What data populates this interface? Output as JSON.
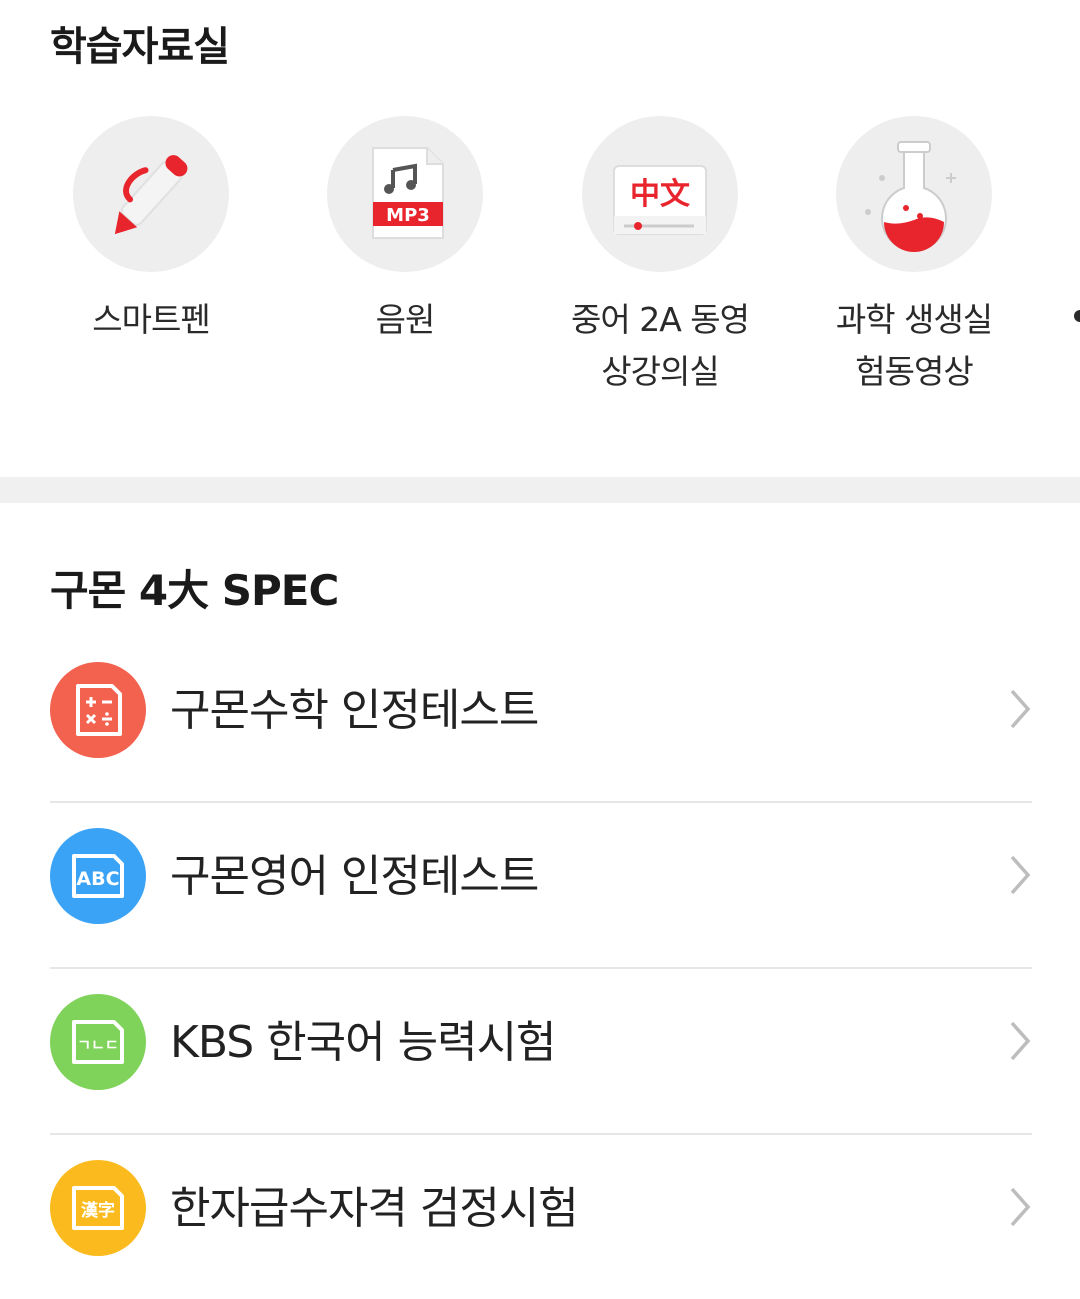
{
  "study_materials": {
    "title": "학습자료실",
    "tiles": [
      {
        "icon": "smart-pen-icon",
        "lines": [
          "스마트펜"
        ]
      },
      {
        "icon": "mp3-file-icon",
        "lines": [
          "음원"
        ]
      },
      {
        "icon": "chinese-video-icon",
        "icon_text": "中文",
        "lines": [
          "중어 2A 동영",
          "상강의실"
        ]
      },
      {
        "icon": "flask-icon",
        "lines": [
          "과학 생생실",
          "험동영상"
        ]
      }
    ],
    "mp3_badge": "MP3"
  },
  "spec": {
    "title": "구몬 4大 SPEC",
    "items": [
      {
        "label": "구몬수학 인정테스트",
        "icon": "math-calculator-icon",
        "color": "#f2624f",
        "icon_text": ""
      },
      {
        "label": "구몬영어 인정테스트",
        "icon": "abc-icon",
        "color": "#3aa3f5",
        "icon_text": "ABC"
      },
      {
        "label": "KBS 한국어 능력시험",
        "icon": "korean-letters-icon",
        "color": "#7fd35a",
        "icon_text": "ㄱㄴㄷ"
      },
      {
        "label": "한자급수자격 검정시험",
        "icon": "hanja-icon",
        "color": "#fbbb1f",
        "icon_text": "漢字"
      }
    ]
  },
  "colors": {
    "accent": "#e8242c",
    "divider": "#f0f0f0"
  }
}
